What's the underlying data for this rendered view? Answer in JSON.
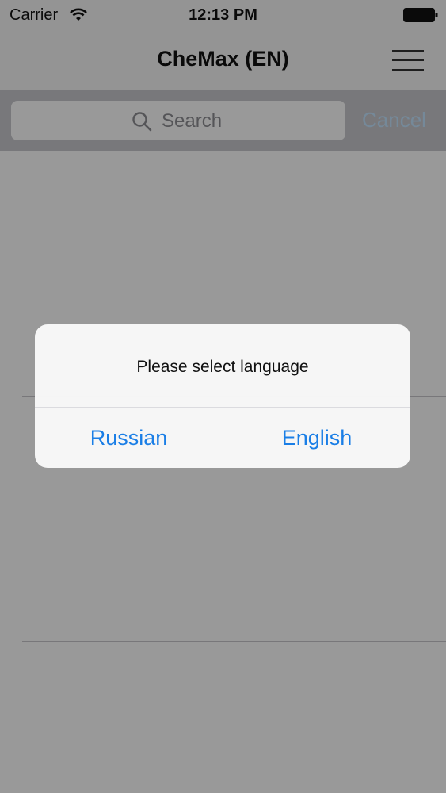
{
  "status_bar": {
    "carrier": "Carrier",
    "time": "12:13 PM",
    "wifi_icon": "wifi-icon",
    "battery_icon": "battery-full-icon"
  },
  "nav": {
    "title": "CheMax (EN)",
    "menu_icon": "hamburger-menu-icon"
  },
  "search": {
    "placeholder": "Search",
    "cancel_label": "Cancel",
    "icon": "search-icon"
  },
  "colors": {
    "accent": "#1a7ee6",
    "search_bar_bg": "#c9c9ce",
    "overlay": "rgba(0,0,0,0.4)"
  },
  "alert": {
    "message": "Please select language",
    "buttons": [
      {
        "label": "Russian"
      },
      {
        "label": "English"
      }
    ]
  }
}
